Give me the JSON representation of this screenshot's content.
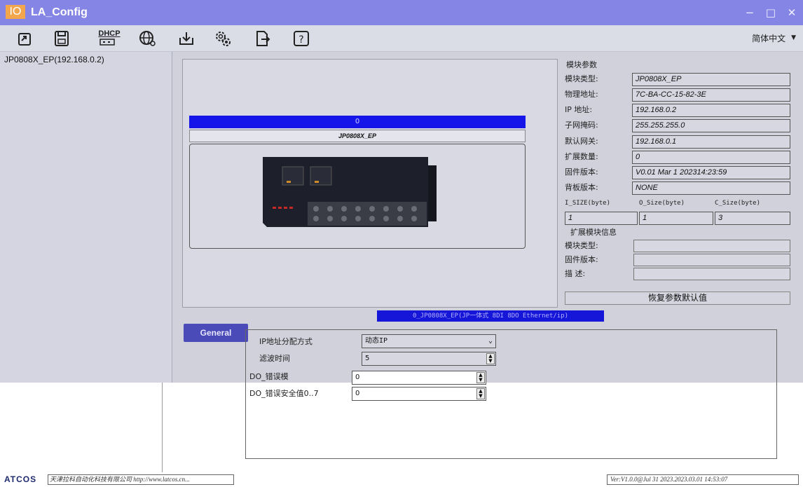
{
  "window": {
    "logo": "IO",
    "title": "LA_Config",
    "minimize": "−",
    "maximize": "□",
    "close": "✕"
  },
  "toolbar": {
    "dhcp_label": "DHCP",
    "language": "简体中文",
    "language_arrow": "▼",
    "icons": [
      "export-icon",
      "save-icon",
      "dhcp-icon",
      "network-search-icon",
      "download-icon",
      "settings-icon",
      "import-icon",
      "help-icon"
    ]
  },
  "tree": {
    "items": [
      "JP0808X_EP(192.168.0.2)"
    ]
  },
  "device": {
    "slot_index": "0",
    "slot_name": "JP0808X_EP"
  },
  "params": {
    "group_title": "模块参数",
    "rows": [
      {
        "label": "模块类型:",
        "value": "JP0808X_EP"
      },
      {
        "label": "物理地址:",
        "value": "7C-BA-CC-15-82-3E"
      },
      {
        "label": " IP 地址:",
        "value": "192.168.0.2"
      },
      {
        "label": "子网掩码:",
        "value": "255.255.255.0"
      },
      {
        "label": "默认网关:",
        "value": "192.168.0.1"
      },
      {
        "label": "扩展数量:",
        "value": "0"
      },
      {
        "label": "固件版本:",
        "value": "V0.01 Mar  1 202314:23:59"
      },
      {
        "label": "背板版本:",
        "value": "NONE"
      }
    ],
    "size_labels": [
      "I_SIZE(byte)",
      "O_Size(byte)",
      "C_Size(byte)"
    ],
    "size_values": [
      "1",
      "1",
      "3"
    ],
    "ext_group_title": "扩展模块信息",
    "ext_labels": [
      "模块类型:",
      "固件版本:",
      "描    述:"
    ],
    "restore_button": "恢复参数默认值"
  },
  "module_tab": "0_JP0808X_EP(JP一体式 8DI 8DO Ethernet/ip)",
  "general_button": "General",
  "config": {
    "ip_mode_label": "IP地址分配方式",
    "ip_mode_value": "动态IP",
    "filter_label": "滤波时间",
    "filter_value": "5",
    "do_mode_label": "DO_错误模",
    "do_mode_value": "0",
    "do_safe_label": "DO_错误安全值0..7",
    "do_safe_value": "0"
  },
  "status": {
    "brand": "ATCOS",
    "left": "天津拉科自动化科技有限公司  http://www.latcos.cn...",
    "right": "Ver:V1.0.0@Jul 31 2023.2023.03.01 14:53:07"
  }
}
